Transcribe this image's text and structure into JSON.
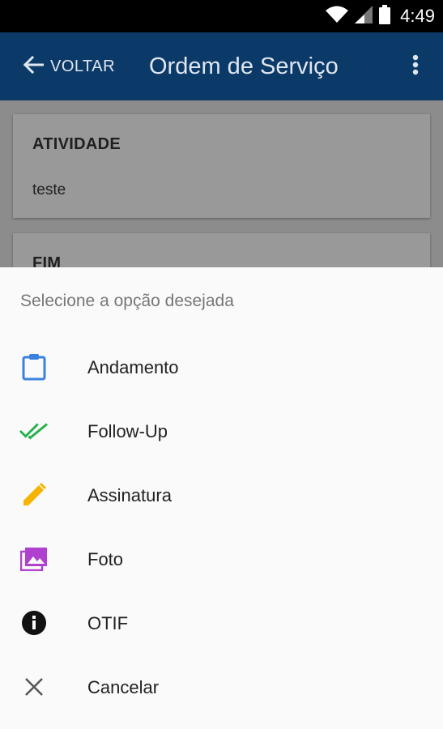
{
  "status_bar": {
    "time": "4:49"
  },
  "app_bar": {
    "back_label": "VOLTAR",
    "title": "Ordem de Serviço"
  },
  "cards": [
    {
      "label": "ATIVIDADE",
      "value": "teste"
    },
    {
      "label": "FIM"
    }
  ],
  "sheet": {
    "title": "Selecione a opção desejada",
    "options": [
      {
        "label": "Andamento",
        "icon": "clipboard-icon",
        "color": "#3b82e0"
      },
      {
        "label": "Follow-Up",
        "icon": "double-check-icon",
        "color": "#22b04a"
      },
      {
        "label": "Assinatura",
        "icon": "pencil-icon",
        "color": "#f5b400"
      },
      {
        "label": "Foto",
        "icon": "photo-library-icon",
        "color": "#b040d0"
      },
      {
        "label": "OTIF",
        "icon": "info-icon",
        "color": "#111111"
      },
      {
        "label": "Cancelar",
        "icon": "close-icon",
        "color": "#555555"
      }
    ]
  }
}
